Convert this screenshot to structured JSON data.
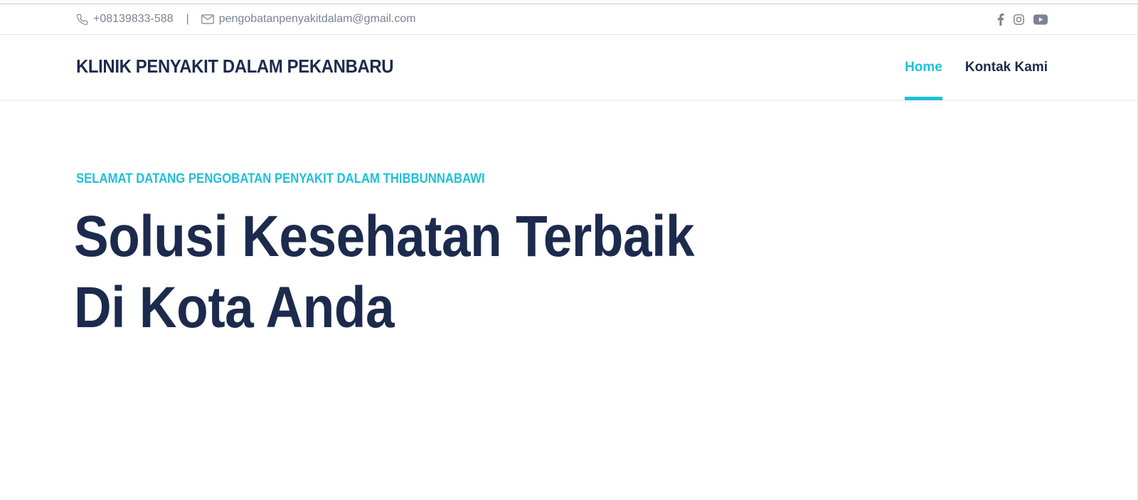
{
  "topbar": {
    "phone": "+08139833-588",
    "separator": "|",
    "email": "pengobatanpenyakitdalam@gmail.com",
    "icons": {
      "phone": "phone-icon",
      "email": "envelope-icon"
    },
    "social": [
      "facebook-icon",
      "instagram-icon",
      "youtube-icon"
    ]
  },
  "header": {
    "brand": "KLINIK PENYAKIT DALAM PEKANBARU",
    "nav": [
      {
        "label": "Home",
        "active": true
      },
      {
        "label": "Kontak Kami",
        "active": false
      }
    ]
  },
  "hero": {
    "subtitle": "SELAMAT DATANG PENGOBATAN PENYAKIT DALAM THIBBUNNABAWI",
    "title_line1": "Solusi Kesehatan Terbaik",
    "title_line2": "Di Kota Anda"
  },
  "colors": {
    "accent": "#1ec0d9",
    "navy": "#1c2b4d",
    "muted": "#7b8291"
  }
}
